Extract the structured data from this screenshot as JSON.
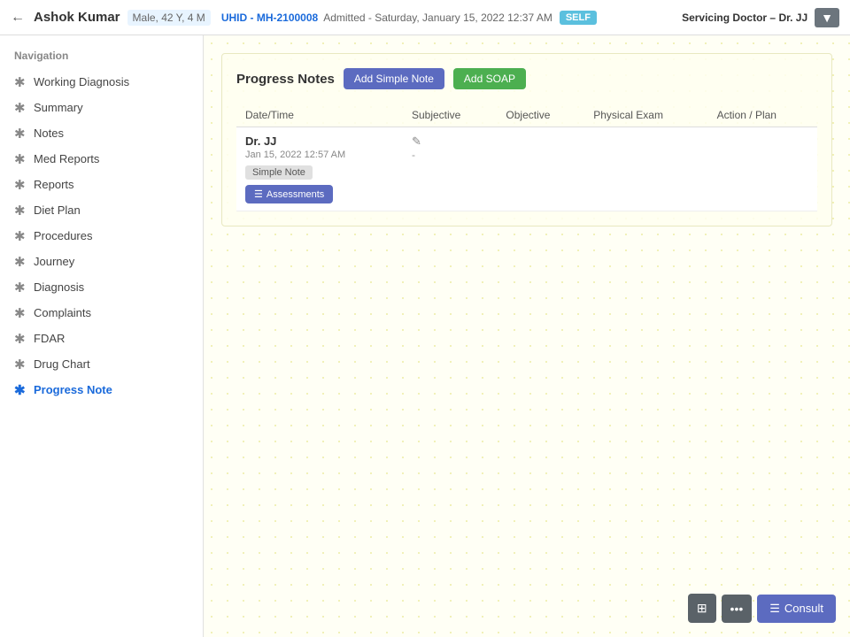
{
  "header": {
    "back_label": "←",
    "patient_name": "Ashok Kumar",
    "patient_meta": "Male, 42 Y, 4 M",
    "uhid_label": "UHID -",
    "uhid_value": "MH-2100008",
    "admitted_label": "Admitted -",
    "admitted_value": "Saturday, January 15, 2022 12:37 AM",
    "self_badge": "SELF",
    "servicing_label": "Servicing Doctor –",
    "servicing_doctor": "Dr. JJ",
    "header_icon": "▼"
  },
  "sidebar": {
    "nav_title": "Navigation",
    "items": [
      {
        "label": "Working Diagnosis",
        "active": false
      },
      {
        "label": "Summary",
        "active": false
      },
      {
        "label": "Notes",
        "active": false
      },
      {
        "label": "Med Reports",
        "active": false
      },
      {
        "label": "Reports",
        "active": false
      },
      {
        "label": "Diet Plan",
        "active": false
      },
      {
        "label": "Procedures",
        "active": false
      },
      {
        "label": "Journey",
        "active": false
      },
      {
        "label": "Diagnosis",
        "active": false
      },
      {
        "label": "Complaints",
        "active": false
      },
      {
        "label": "FDAR",
        "active": false
      },
      {
        "label": "Drug Chart",
        "active": false
      },
      {
        "label": "Progress Note",
        "active": true
      }
    ]
  },
  "main": {
    "section_title": "Progress Notes",
    "add_simple_label": "Add Simple Note",
    "add_soap_label": "Add SOAP",
    "table": {
      "columns": [
        "Date/Time",
        "Subjective",
        "Objective",
        "Physical Exam",
        "Action / Plan"
      ],
      "rows": [
        {
          "doctor": "Dr. JJ",
          "datetime": "Jan 15, 2022 12:57 AM",
          "note_type": "Simple Note",
          "has_edit": true,
          "subjective_dash": "-",
          "assessments_label": "Assessments",
          "assessments_icon": "☰"
        }
      ]
    }
  },
  "bottom_bar": {
    "grid_icon": "⊞",
    "dots_icon": "•••",
    "consult_icon": "☰",
    "consult_label": "Consult"
  }
}
